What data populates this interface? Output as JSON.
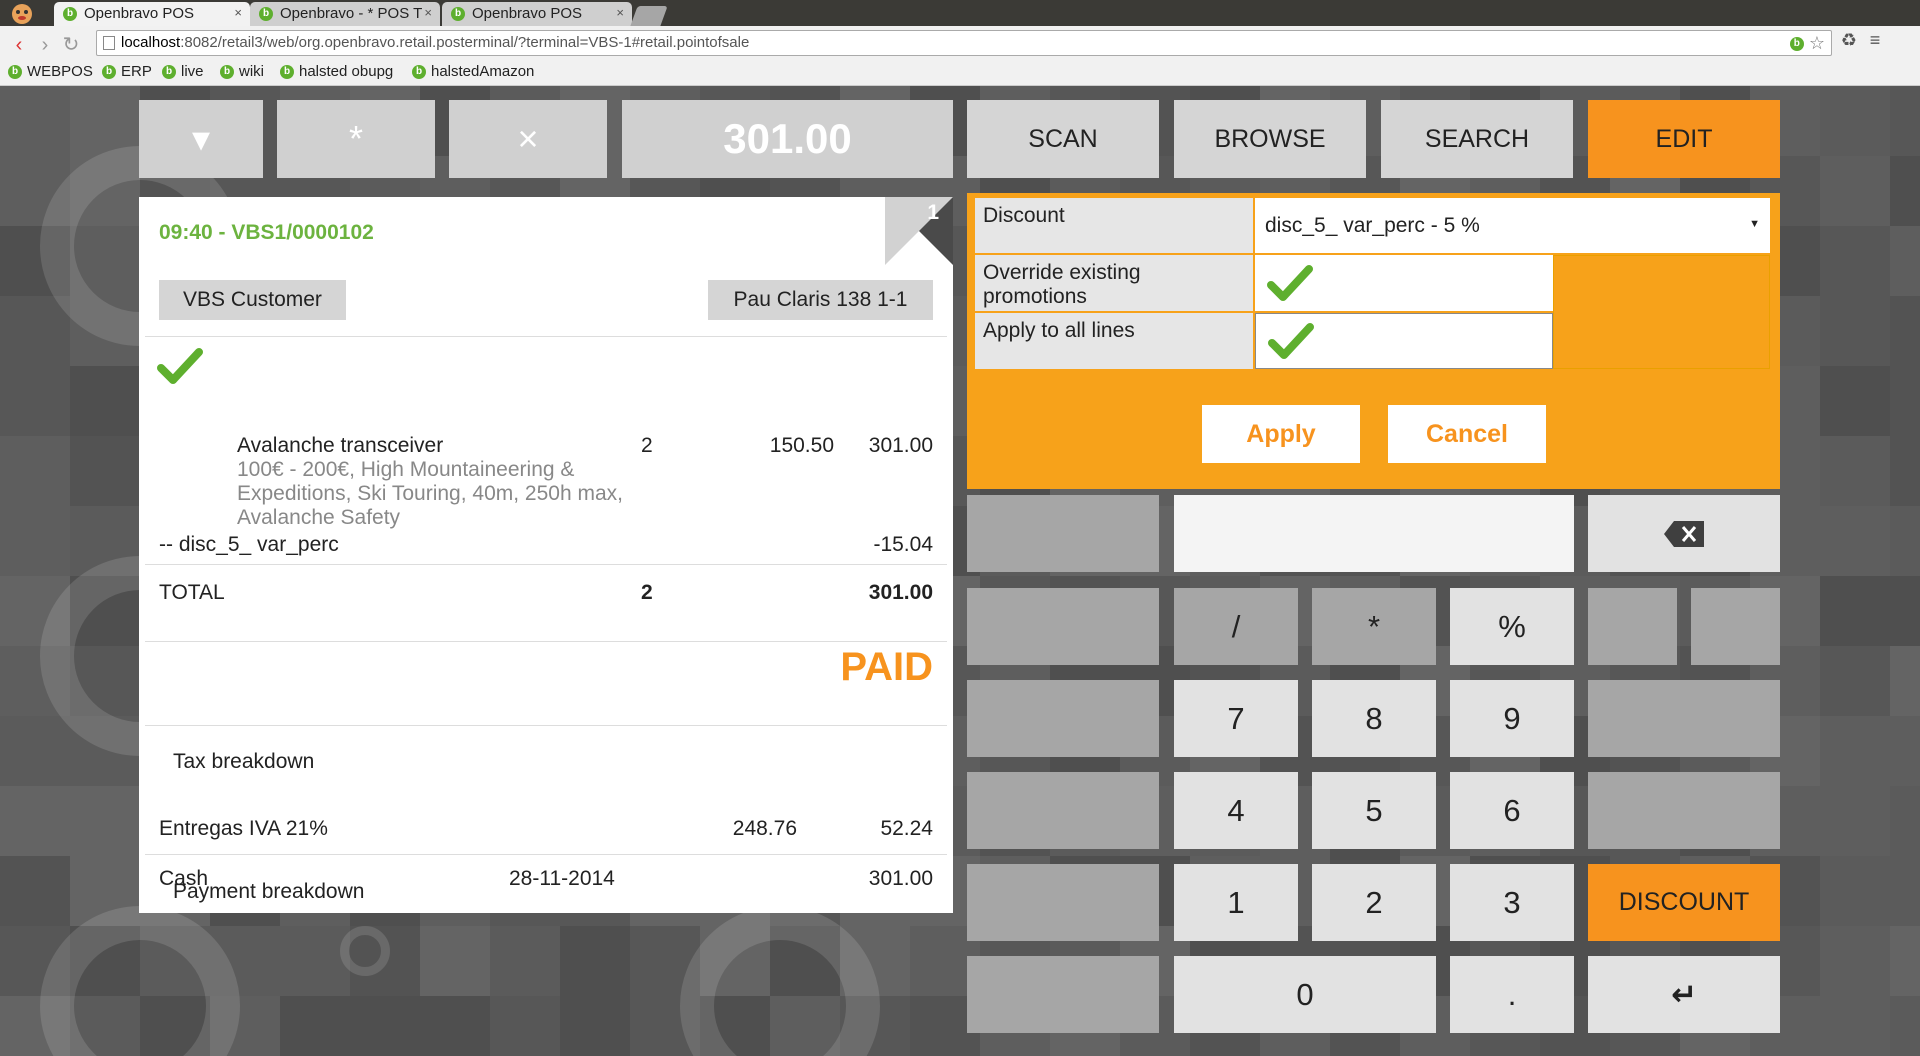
{
  "browser": {
    "tabs": [
      {
        "title": "Openbravo POS",
        "close": "×"
      },
      {
        "title": "Openbravo - * POS T",
        "close": "×"
      },
      {
        "title": "Openbravo POS",
        "close": "×"
      }
    ],
    "url_host": "localhost",
    "url_rest": ":8082/retail3/web/org.openbravo.retail.posterminal/?terminal=VBS-1#retail.pointofsale",
    "bookmarks": [
      "WEBPOS",
      "ERP",
      "live",
      "wiki",
      "halsted obupg",
      "halstedAmazon"
    ]
  },
  "pos": {
    "top_buttons": {
      "menu": "▾",
      "asterisk": "*",
      "clear": "×",
      "total": "301.00"
    },
    "tabs": [
      "SCAN",
      "BROWSE",
      "SEARCH",
      "EDIT"
    ],
    "receipt": {
      "corner_number": "1",
      "order_id": "09:40 - VBS1/0000102",
      "customer": "VBS Customer",
      "address": "Pau Claris 138 1-1",
      "line": {
        "product": "Avalanche transceiver",
        "qty": "2",
        "price": "150.50",
        "amount": "301.00",
        "description": "100€ - 200€, High Mountaineering & Expeditions, Ski Touring, 40m, 250h max, Avalanche Safety",
        "discount_name": "-- disc_5_ var_perc",
        "discount_amount": "-15.04"
      },
      "total_label": "TOTAL",
      "total_qty": "2",
      "total_amount": "301.00",
      "status": "PAID",
      "tax_header": "Tax breakdown",
      "tax": {
        "name": "Entregas IVA 21%",
        "base": "248.76",
        "amount": "52.24"
      },
      "payment_header": "Payment breakdown",
      "payment": {
        "method": "Cash",
        "date": "28-11-2014",
        "amount": "301.00"
      }
    },
    "discount_panel": {
      "discount_label": "Discount",
      "discount_value": "disc_5_ var_perc - 5 %",
      "override_label": "Override existing promotions",
      "override_checked": true,
      "apply_all_label": "Apply to all lines",
      "apply_all_checked": true,
      "apply_button": "Apply",
      "cancel_button": "Cancel"
    },
    "keypad": {
      "backspace": "⌫",
      "row1": [
        "/",
        "*",
        "%"
      ],
      "row2": [
        "7",
        "8",
        "9"
      ],
      "row3": [
        "4",
        "5",
        "6"
      ],
      "row4": [
        "1",
        "2",
        "3"
      ],
      "zero": "0",
      "dot": ".",
      "discount": "DISCOUNT",
      "enter": "↵"
    },
    "colors": {
      "accent": "#f7931e",
      "panel": "#f7a21a",
      "brand_green": "#6cb33f"
    }
  }
}
